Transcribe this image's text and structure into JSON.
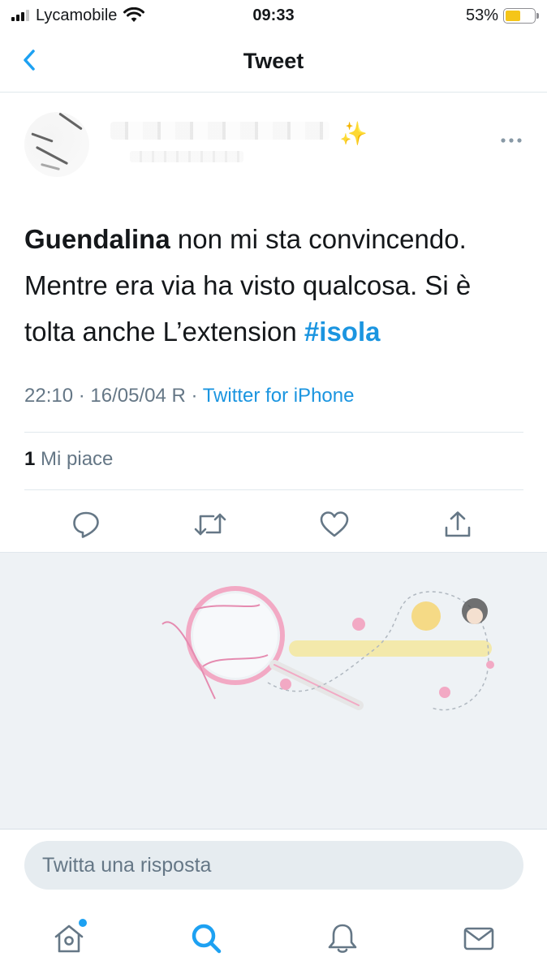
{
  "status_bar": {
    "carrier": "Lycamobile",
    "time": "09:33",
    "battery_percent_label": "53%",
    "battery_level": 0.53
  },
  "nav": {
    "title": "Tweet"
  },
  "tweet": {
    "text_parts": {
      "bold_name": "Guendalina",
      "body": " non mi sta convincendo. Mentre era via ha visto qualcosa. Si è tolta anche L’extension ",
      "hashtag": "#isola"
    },
    "timestamp": "22:10 · 16/05/04 R · ",
    "source": "Twitter for iPhone",
    "likes_count": "1",
    "likes_label": " Mi piace"
  },
  "reply": {
    "placeholder": "Twitta una risposta"
  },
  "icons": {
    "back": "chevron-left-icon",
    "more": "more-icon",
    "reply": "reply-icon",
    "retweet": "retweet-icon",
    "like": "heart-icon",
    "share": "share-icon",
    "home": "home-icon",
    "search": "search-icon",
    "notifications": "bell-icon",
    "messages": "mail-icon"
  },
  "colors": {
    "accent": "#1da1f2",
    "link": "#1b95e0",
    "muted": "#657786",
    "battery": "#f5c518"
  }
}
